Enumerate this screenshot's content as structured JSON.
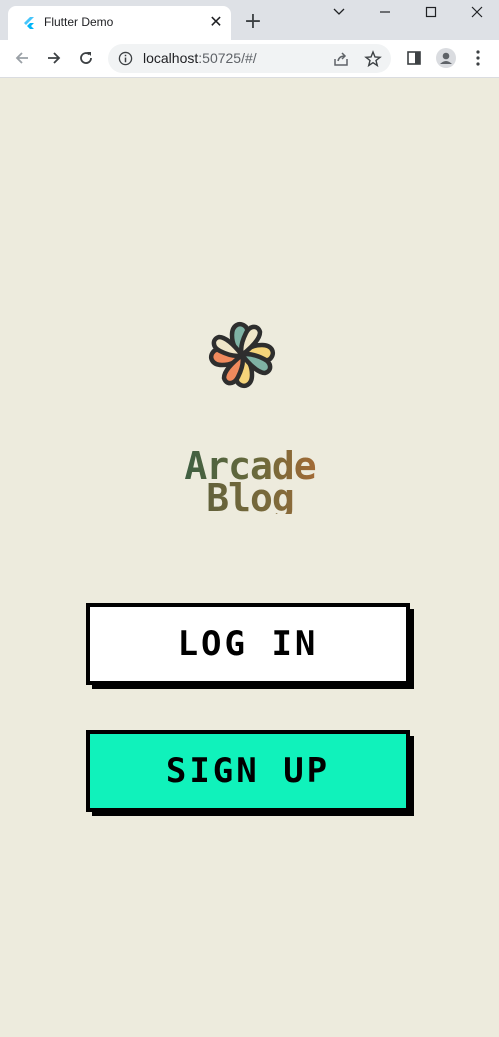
{
  "browser": {
    "tab_title": "Flutter Demo",
    "url_host": "localhost",
    "url_rest": ":50725/#/",
    "icons": [
      "flutter-icon",
      "close-icon",
      "plus-icon",
      "chevron-down-icon",
      "minimize-icon",
      "maximize-icon",
      "close-window-icon",
      "back-icon",
      "forward-icon",
      "reload-icon",
      "info-icon",
      "share-icon",
      "star-icon",
      "side-panel-icon",
      "profile-icon",
      "more-icon"
    ]
  },
  "app": {
    "title_line1": "Arcade",
    "title_line2": "Blog",
    "login_label": "LOG IN",
    "signup_label": "SIGN UP",
    "colors": {
      "background": "#edebdd",
      "signup_button": "#10f2bb",
      "login_button": "#ffffff",
      "petal_orange": "#f08a5d",
      "petal_teal": "#7fb2a4",
      "petal_yellow": "#f5d47a",
      "petal_cream": "#f0e6c8",
      "outline": "#2e2e2e"
    }
  }
}
